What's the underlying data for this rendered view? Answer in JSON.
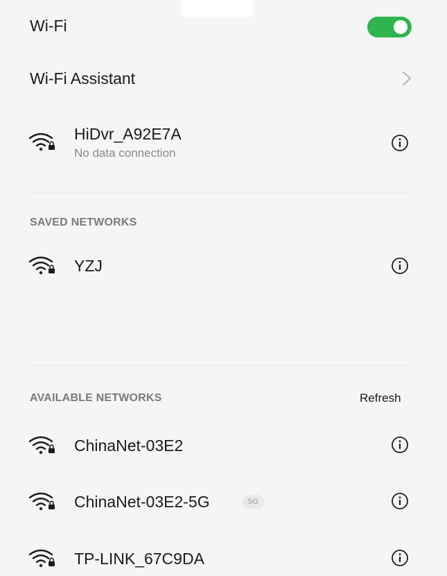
{
  "wifi": {
    "label": "Wi-Fi",
    "enabled": true,
    "toggle_color": "#2fb44f"
  },
  "assistant": {
    "label": "Wi-Fi Assistant",
    "icon": "chevron-right-icon"
  },
  "connected": {
    "name": "HiDvr_A92E7A",
    "status": "No data connection",
    "icon": "wifi-locked-icon"
  },
  "saved": {
    "header": "SAVED NETWORKS",
    "networks": [
      {
        "name": "YZJ",
        "icon": "wifi-locked-icon"
      }
    ]
  },
  "available": {
    "header": "AVAILABLE NETWORKS",
    "refresh_label": "Refresh",
    "networks": [
      {
        "name": "ChinaNet-03E2",
        "icon": "wifi-locked-icon"
      },
      {
        "name": "ChinaNet-03E2-5G",
        "badge": "5G",
        "icon": "wifi-locked-icon"
      },
      {
        "name": "TP-LINK_67C9DA",
        "icon": "wifi-locked-icon"
      }
    ]
  },
  "colors": {
    "background": "#f5f5f5",
    "accent": "#2fb44f",
    "secondary_text": "#8a8a8a",
    "section_header": "#7a7a7a"
  }
}
